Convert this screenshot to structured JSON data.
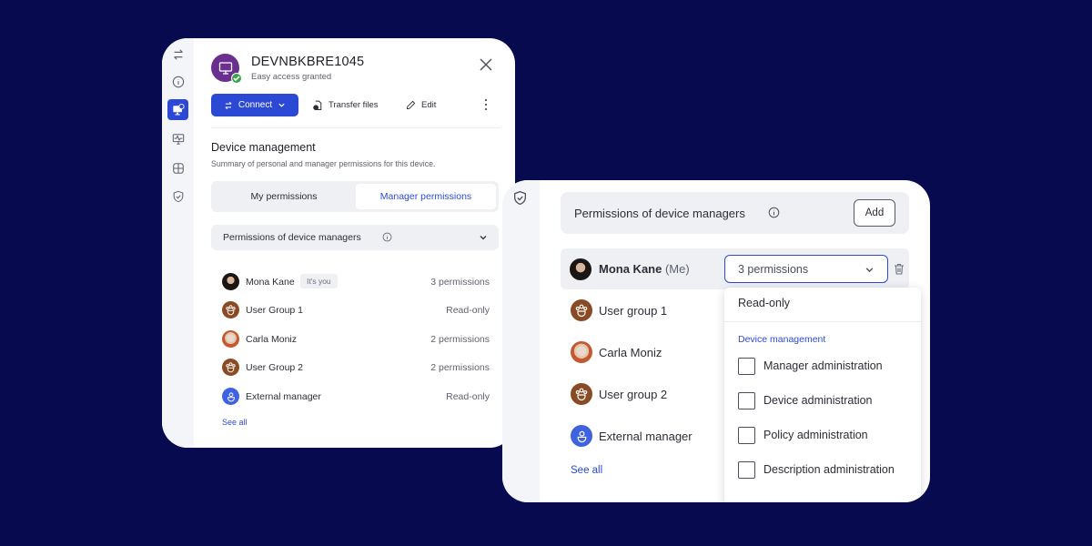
{
  "colors": {
    "background": "#070a4f",
    "accent": "#2c49d6",
    "device_avatar": "#6b2f8f",
    "status_ok": "#3aa34a",
    "group_avatar": "#8a4b24",
    "external_avatar": "#3f63e0"
  },
  "left_card": {
    "rail_icons": [
      "transfer-arrows-icon",
      "info-icon",
      "device-icon",
      "monitor-activity-icon",
      "grid-icon",
      "shield-check-icon"
    ],
    "device": {
      "name": "DEVNBKBRE1045",
      "status": "Easy access granted"
    },
    "toolbar": {
      "connect_label": "Connect",
      "transfer_label": "Transfer files",
      "edit_label": "Edit"
    },
    "section": {
      "title": "Device management",
      "subtitle": "Summary of personal and manager permissions for this device."
    },
    "tabs": [
      {
        "label": "My permissions",
        "selected": false
      },
      {
        "label": "Manager permissions",
        "selected": true
      }
    ],
    "accordion": {
      "label": "Permissions of device managers"
    },
    "managers": [
      {
        "name": "Mona Kane",
        "badge": "It's you",
        "value": "3 permissions",
        "avatar": "photo"
      },
      {
        "name": "User Group 1",
        "value": "Read-only",
        "avatar": "group"
      },
      {
        "name": "Carla Moniz",
        "value": "2 permissions",
        "avatar": "photo"
      },
      {
        "name": "User Group 2",
        "value": "2 permissions",
        "avatar": "group"
      },
      {
        "name": "External manager",
        "value": "Read-only",
        "avatar": "external"
      }
    ],
    "see_all": "See all"
  },
  "right_card": {
    "header": {
      "label": "Permissions of device managers",
      "add_label": "Add"
    },
    "me_row": {
      "name": "Mona Kane",
      "suffix": "(Me)",
      "selected_value": "3 permissions"
    },
    "managers": [
      {
        "name": "User group 1",
        "avatar": "group"
      },
      {
        "name": "Carla Moniz",
        "avatar": "photo"
      },
      {
        "name": "User group 2",
        "avatar": "group"
      },
      {
        "name": "External manager",
        "avatar": "external"
      }
    ],
    "see_all": "See all",
    "dropdown": {
      "top_option": "Read-only",
      "group_label": "Device management",
      "options": [
        {
          "label": "Manager administration",
          "checked": false
        },
        {
          "label": "Device administration",
          "checked": false
        },
        {
          "label": "Policy administration",
          "checked": false
        },
        {
          "label": "Description administration",
          "checked": false
        }
      ]
    }
  }
}
